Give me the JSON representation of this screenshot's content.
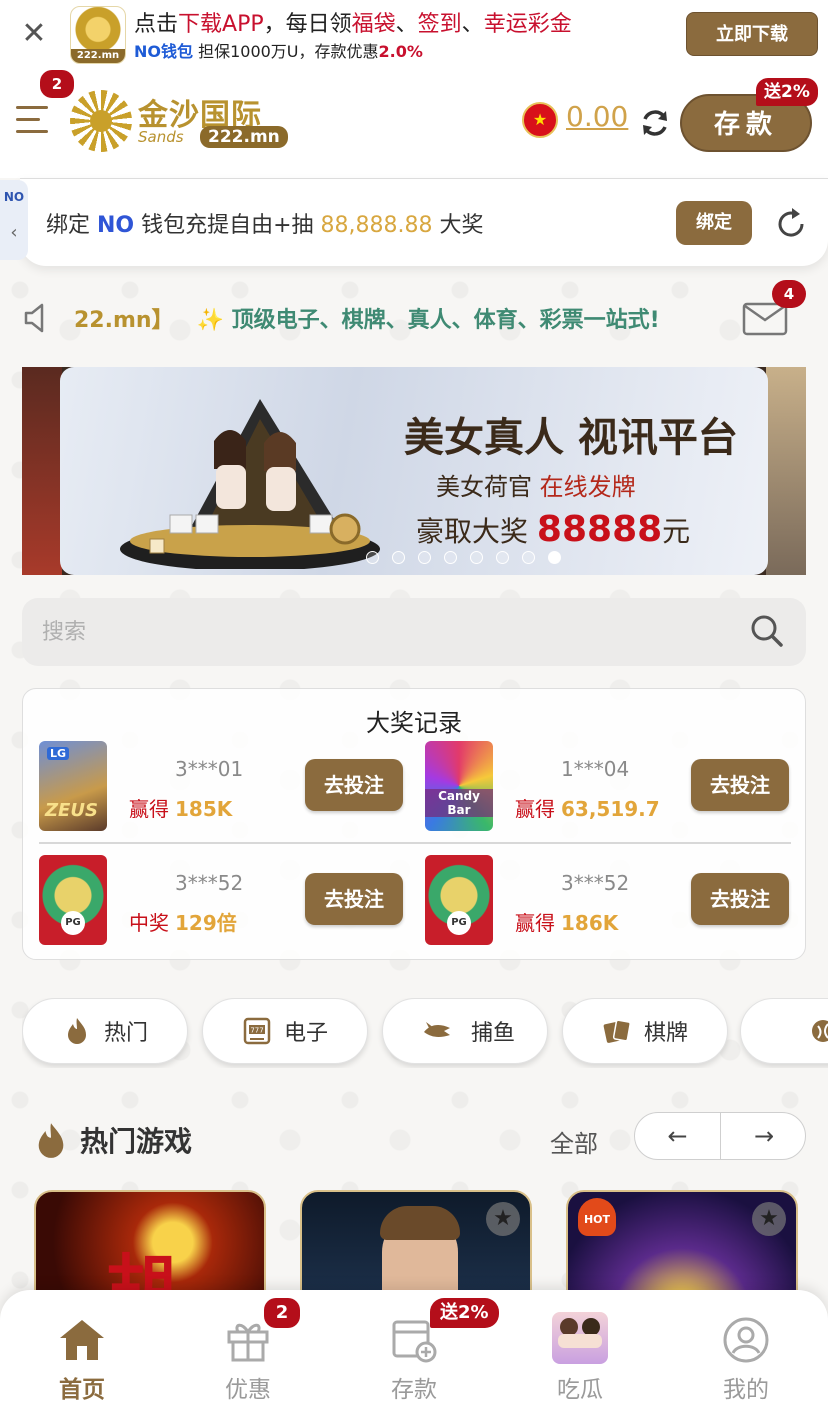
{
  "download_bar": {
    "line1_prefix": "点击",
    "line1_app": "下载APP",
    "line1_mid": "，每日领",
    "line1_bag": "福袋",
    "line1_sep1": "、",
    "line1_sign": "签到",
    "line1_sep2": "、",
    "line1_lucky": "幸运彩金",
    "line2_wallet": "NO钱包",
    "line2_mid": " 担保1000万U，存款优惠",
    "line2_rate": "2.0%",
    "button": "立即下载",
    "logo_domain": "222.mn"
  },
  "header": {
    "menu_badge": "2",
    "logo_cn": "金沙国际",
    "logo_en": "Sands",
    "logo_domain": "222.mn",
    "flag_icon": "china-flag-icon",
    "balance": "0.00",
    "deposit_label": "存款",
    "deposit_badge": "送2%"
  },
  "bind_bar": {
    "side_tab": "NO",
    "text_prefix": "绑定 ",
    "text_no": "NO",
    "text_mid": " 钱包充提自由+抽 ",
    "amount": "88,888.88",
    "text_suffix": " 大奖",
    "button": "绑定"
  },
  "marquee": {
    "part1": "22.mn】",
    "part2": "✨ 顶级电子、棋牌、真人、体育、彩票一站式!",
    "mail_badge": "4"
  },
  "banner": {
    "title": "美女真人 视讯平台",
    "subtitle_prefix": "美女荷官",
    "subtitle_suffix": "在线发牌",
    "prize_prefix": "豪取大奖",
    "prize_amount": "88888",
    "prize_unit": "元",
    "dots_total": 8,
    "dots_active": 8
  },
  "search": {
    "placeholder": "搜索"
  },
  "records": {
    "title": "大奖记录",
    "items": [
      {
        "user": "3***01",
        "label": "赢得",
        "value": "185K",
        "button": "去投注",
        "game": "zeus"
      },
      {
        "user": "1***04",
        "label": "赢得",
        "value": "63,519.7",
        "button": "去投注",
        "game": "candy-bar"
      },
      {
        "user": "3***52",
        "label": "中奖",
        "value": "129倍",
        "button": "去投注",
        "game": "pg-element"
      },
      {
        "user": "3***52",
        "label": "赢得",
        "value": "186K",
        "button": "去投注",
        "game": "pg-element"
      }
    ]
  },
  "categories": [
    {
      "label": "热门",
      "icon": "flame-icon"
    },
    {
      "label": "电子",
      "icon": "slot-machine-icon"
    },
    {
      "label": "捕鱼",
      "icon": "fish-icon"
    },
    {
      "label": "棋牌",
      "icon": "cards-icon"
    }
  ],
  "hot_games": {
    "title": "热门游戏",
    "all": "全部",
    "prev": "←",
    "next": "→",
    "hot_tag": "HOT"
  },
  "bottom_nav": [
    {
      "label": "首页",
      "icon": "home-icon",
      "active": true
    },
    {
      "label": "优惠",
      "icon": "gift-icon",
      "badge": "2"
    },
    {
      "label": "存款",
      "icon": "deposit-icon",
      "badge": "送2%"
    },
    {
      "label": "吃瓜",
      "icon": "girls-avatar-icon"
    },
    {
      "label": "我的",
      "icon": "user-icon"
    }
  ],
  "colors": {
    "brand_gold": "#8b6b3e",
    "accent_red": "#b40e1a",
    "amount_gold": "#e2a53a"
  }
}
